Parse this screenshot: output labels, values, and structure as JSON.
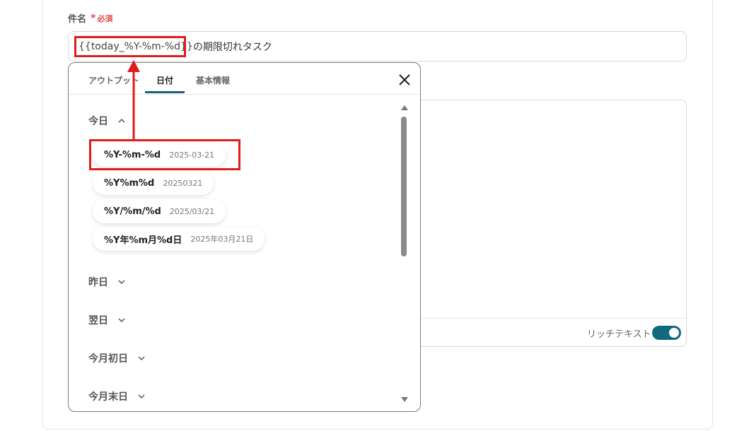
{
  "form": {
    "subject_label": "件名",
    "required_mark": "*",
    "required_text": "必須",
    "subject_token": "{{today_%Y-%m-%d}}",
    "subject_suffix": "の期限切れタスク",
    "rich_text_label": "リッチテキスト",
    "rich_text_enabled": true
  },
  "popover": {
    "tabs": [
      {
        "label": "アウトプット",
        "active": false
      },
      {
        "label": "日付",
        "active": true
      },
      {
        "label": "基本情報",
        "active": false
      }
    ],
    "close_icon": "close-icon",
    "sections": {
      "today": {
        "label": "今日",
        "expanded": true,
        "options": [
          {
            "format": "%Y-%m-%d",
            "sample": "2025-03-21"
          },
          {
            "format": "%Y%m%d",
            "sample": "20250321"
          },
          {
            "format": "%Y/%m/%d",
            "sample": "2025/03/21"
          },
          {
            "format": "%Y年%m月%d日",
            "sample": "2025年03月21日"
          }
        ]
      },
      "yesterday": {
        "label": "昨日",
        "expanded": false
      },
      "tomorrow": {
        "label": "翌日",
        "expanded": false
      },
      "month_start": {
        "label": "今月初日",
        "expanded": false
      },
      "month_end": {
        "label": "今月末日",
        "expanded": false
      }
    }
  },
  "colors": {
    "accent": "#1b5f73",
    "toggle": "#0f6a7e",
    "annotation": "#e21b1b",
    "required": "#e34c4c"
  }
}
